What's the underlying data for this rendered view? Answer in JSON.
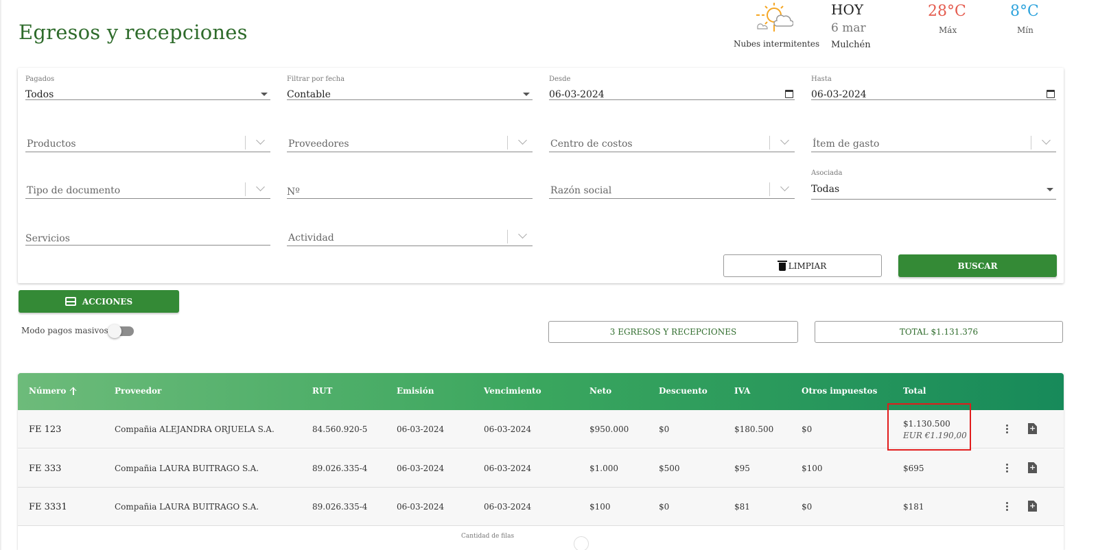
{
  "page": {
    "title": "Egresos y recepciones"
  },
  "weather": {
    "icon": "partly-cloudy-sun-icon",
    "description": "Nubes intermitentes",
    "day_label": "HOY",
    "date": "6 mar",
    "city": "Mulchén",
    "max_temp": "28°C",
    "max_label": "Máx",
    "min_temp": "8°C",
    "min_label": "Mín",
    "max_color": "#e45b4e",
    "min_color": "#2ea3dc"
  },
  "filters": {
    "pagados": {
      "label": "Pagados",
      "value": "Todos"
    },
    "filtrar_fecha": {
      "label": "Filtrar por fecha",
      "value": "Contable"
    },
    "desde": {
      "label": "Desde",
      "value": "06-03-2024"
    },
    "hasta": {
      "label": "Hasta",
      "value": "06-03-2024"
    },
    "productos": {
      "placeholder": "Productos"
    },
    "proveedores": {
      "placeholder": "Proveedores"
    },
    "centro_costos": {
      "placeholder": "Centro de costos"
    },
    "item_gasto": {
      "placeholder": "Ítem de gasto"
    },
    "tipo_documento": {
      "placeholder": "Tipo de documento"
    },
    "numero": {
      "placeholder": "Nº"
    },
    "razon_social": {
      "placeholder": "Razón social"
    },
    "asociada": {
      "label": "Asociada",
      "value": "Todas"
    },
    "servicios": {
      "placeholder": "Servicios"
    },
    "actividad": {
      "placeholder": "Actividad"
    },
    "limpiar_label": "LIMPIAR",
    "buscar_label": "BUSCAR"
  },
  "actions": {
    "acciones_label": "ACCIONES",
    "modo_pagos_label": "Modo pagos masivos",
    "modo_pagos_on": false,
    "count_label": "3 EGRESOS Y RECEPCIONES",
    "total_label": "TOTAL $1.131.376"
  },
  "table": {
    "headers": [
      "Número",
      "Proveedor",
      "RUT",
      "Emisión",
      "Vencimiento",
      "Neto",
      "Descuento",
      "IVA",
      "Otros impuestos",
      "Total"
    ],
    "rows": [
      {
        "numero": "FE 123",
        "proveedor": "Compañia ALEJANDRA ORJUELA S.A.",
        "rut": "84.560.920-5",
        "emision": "06-03-2024",
        "vencimiento": "06-03-2024",
        "neto": "$950.000",
        "descuento": "$0",
        "iva": "$180.500",
        "otros": "$0",
        "total": "$1.130.500",
        "total_eur": "EUR €1.190,00"
      },
      {
        "numero": "FE 333",
        "proveedor": "Compañia LAURA BUITRAGO S.A.",
        "rut": "89.026.335-4",
        "emision": "06-03-2024",
        "vencimiento": "06-03-2024",
        "neto": "$1.000",
        "descuento": "$500",
        "iva": "$95",
        "otros": "$100",
        "total": "$695"
      },
      {
        "numero": "FE 3331",
        "proveedor": "Compañia LAURA BUITRAGO S.A.",
        "rut": "89.026.335-4",
        "emision": "06-03-2024",
        "vencimiento": "06-03-2024",
        "neto": "$100",
        "descuento": "$0",
        "iva": "$81",
        "otros": "$0",
        "total": "$181"
      }
    ],
    "footer_rows_label": "Cantidad de filas",
    "header_color_start": "#6dbb7a",
    "header_color_end": "#178a5a"
  }
}
